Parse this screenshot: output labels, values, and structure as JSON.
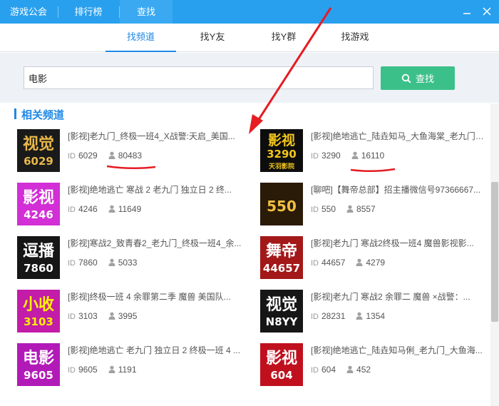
{
  "nav": {
    "tabs": [
      {
        "label": "游戏公会"
      },
      {
        "label": "排行榜"
      },
      {
        "label": "查找"
      }
    ]
  },
  "subtabs": [
    {
      "label": "找频道"
    },
    {
      "label": "找Y友"
    },
    {
      "label": "找Y群"
    },
    {
      "label": "找游戏"
    }
  ],
  "search": {
    "value": "电影",
    "button_label": "查找"
  },
  "section": {
    "title": "相关频道"
  },
  "id_label": "ID",
  "channels": [
    {
      "title": "[影视]老九门_终极一班4_X战警:天启_美国...",
      "id": "6029",
      "members": "80483",
      "thumb": {
        "line1": "视觉",
        "line2": "6029",
        "bg": "#1a1a1a",
        "fg": "#e9b84a"
      }
    },
    {
      "title": "[影视]绝地逃亡_陆垚知马_大鱼海棠_老九门_...",
      "id": "3290",
      "members": "16110",
      "thumb": {
        "line1": "影视",
        "line2": "3290",
        "line3": "天羽影院",
        "bg": "#0d0d0d",
        "fg": "#f3c61c"
      }
    },
    {
      "title": "[影视]绝地逃亡 寒战 2 老九门 独立日 2 终...",
      "id": "4246",
      "members": "11649",
      "thumb": {
        "line1": "影视",
        "line2": "4246",
        "bg": "#d22fd6",
        "fg": "#ffffff"
      }
    },
    {
      "title": "[聊吧]【舞帝总部】招主播微信号97366667...",
      "id": "550",
      "members": "8557",
      "thumb": {
        "line1": "550",
        "bg": "#2a1a08",
        "fg": "#f0c040"
      }
    },
    {
      "title": "[影视]寒战2_致青春2_老九门_终极一班4_余...",
      "id": "7860",
      "members": "5033",
      "thumb": {
        "line1": "逗播",
        "line2": "7860",
        "bg": "#161616",
        "fg": "#ffffff"
      }
    },
    {
      "title": "[影视]老九门 寒战2终极一班4 魔兽影视影...",
      "id": "44657",
      "members": "4279",
      "thumb": {
        "line1": "舞帝",
        "line2": "44657",
        "bg": "#a31818",
        "fg": "#ffffff"
      }
    },
    {
      "title": "[影视]终极一班 4 余罪第二季 魔兽 美国队...",
      "id": "3103",
      "members": "3995",
      "thumb": {
        "line1": "小收",
        "line2": "3103",
        "bg": "#c31ca8",
        "fg": "#fff200"
      }
    },
    {
      "title": "[影视]老九门 寒战2 余罪二 魔兽 ×战警：...",
      "id": "28231",
      "members": "1354",
      "thumb": {
        "line1": "视觉",
        "line2": "N8YY",
        "bg": "#161616",
        "fg": "#ffffff"
      }
    },
    {
      "title": "[影视]绝地逃亡 老九门 独立日 2 终极一班 4 ...",
      "id": "9605",
      "members": "1191",
      "thumb": {
        "line1": "电影",
        "line2": "9605",
        "bg": "#b21ab8",
        "fg": "#ffffff"
      }
    },
    {
      "title": "[影视]绝地逃亡_陆垚知马俐_老九门_大鱼海...",
      "id": "604",
      "members": "452",
      "thumb": {
        "line1": "影视",
        "line2": "604",
        "bg": "#c0101e",
        "fg": "#ffffff"
      }
    }
  ],
  "colors": {
    "titlebar": "#29a0ee",
    "accent": "#1e88e5",
    "search_button": "#3cc08a",
    "annotation": "#e51c23"
  }
}
